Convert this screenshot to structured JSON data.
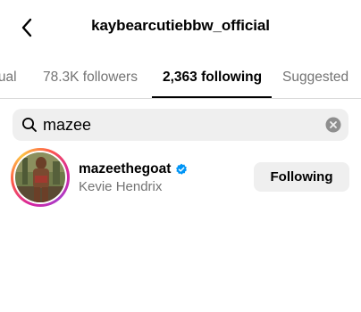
{
  "header": {
    "title": "kaybearcutiebbw_official",
    "back_icon": "chevron-left-icon"
  },
  "tabs": [
    {
      "label": "Mutual",
      "active": false
    },
    {
      "label": "78.3K followers",
      "active": false
    },
    {
      "label": "2,363 following",
      "active": true
    },
    {
      "label": "Suggested",
      "active": false
    }
  ],
  "search": {
    "value": "mazee",
    "icon": "search-icon",
    "clear_icon": "clear-circle-icon"
  },
  "results": [
    {
      "username": "mazeethegoat",
      "verified": true,
      "full_name": "Kevie Hendrix",
      "button_label": "Following",
      "has_story_ring": true
    }
  ],
  "colors": {
    "text_primary": "#000000",
    "text_secondary": "#737373",
    "input_bg": "#efefef",
    "divider": "#dbdbdb",
    "verified_blue": "#0095f6",
    "story_ring_start": "#d6249f",
    "story_ring_end": "#fdc345"
  }
}
